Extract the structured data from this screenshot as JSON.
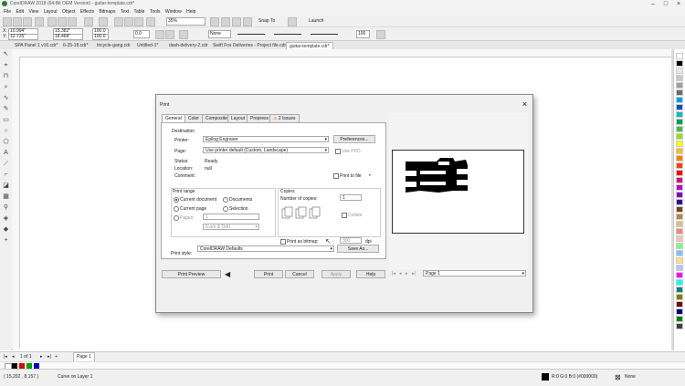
{
  "app": {
    "title": "CorelDRAW 2018 (64-Bit OEM Version) - guitar-template.cdr*"
  },
  "menu": [
    "File",
    "Edit",
    "View",
    "Layout",
    "Object",
    "Effects",
    "Bitmaps",
    "Text",
    "Table",
    "Tools",
    "Window",
    "Help"
  ],
  "toolbar": {
    "zoom": "35%",
    "snap_to": "Snap To",
    "launch": "Launch",
    "x": "10.994\"",
    "y": "12.725\"",
    "w": "15.382\"",
    "h": "18.468\"",
    "sx": "100.0",
    "sy": "100.0",
    "angle": "0.0",
    "outline": "None",
    "tab_value": "100"
  },
  "doc_tabs": [
    "SPA Panel 1 v16.cdr*",
    "6-25-18.cdr*",
    "tricycle-gang.cdr",
    "Untitled-1*",
    "dash-delivery-2.cdr",
    "Swift Fox Deliveries - Project file.cdr*",
    "guitar-template.cdr*"
  ],
  "dialog": {
    "title": "Print",
    "tabs": [
      "General",
      "Color",
      "Composite",
      "Layout",
      "Prepress",
      "2 Issues"
    ],
    "destination": {
      "heading": "Destination",
      "printer_label": "Printer:",
      "printer_value": "Epilog Engraver",
      "preferences": "Preferences...",
      "page_label": "Page:",
      "page_value": "Use printer default (Custom, Landscape)",
      "use_ppd": "Use PPD",
      "status_label": "Status:",
      "status_value": "Ready",
      "location_label": "Location:",
      "location_value": "null",
      "comment_label": "Comment:",
      "print_to_file": "Print to file"
    },
    "range": {
      "heading": "Print range",
      "current_document": "Current document",
      "documents": "Documents",
      "current_page": "Current page",
      "selection": "Selection",
      "pages": "Pages:",
      "pages_value": "1",
      "even_odd": "Even & Odd"
    },
    "copies": {
      "heading": "Copies",
      "number_label": "Number of copies:",
      "number_value": "1",
      "collate": "Collate"
    },
    "bitmap": {
      "label": "Print as bitmap:",
      "dpi_value": "300",
      "dpi_unit": "dpi"
    },
    "style": {
      "label": "Print style:",
      "value": "CorelDRAW Defaults",
      "save_as": "Save As..."
    },
    "buttons": {
      "preview": "Print Preview",
      "print": "Print",
      "cancel": "Cancel",
      "apply": "Apply",
      "help": "Help"
    },
    "page_nav": "Page 1"
  },
  "page_tab": "Page 1",
  "page_counter": "1 of 1",
  "status": {
    "coords": "( 15.202 , 8.157 )",
    "object": "Curve on Layer 1",
    "fill": "R:0 G:0 B:0 (#000000)",
    "outline": "None"
  },
  "colors": {
    "accent": "#f0a030",
    "palette": [
      "#ffffff",
      "#000000",
      "#e8e8e8",
      "#c8c8c8",
      "#a0a0a0",
      "#6e6e6e",
      "#00a0e0",
      "#0050c0",
      "#00c0c0",
      "#00a050",
      "#40c040",
      "#a0e000",
      "#ffff00",
      "#ffc000",
      "#ff8000",
      "#ff4000",
      "#ff0000",
      "#e0007a",
      "#c000c0",
      "#8000c0",
      "#4000a0",
      "#804020",
      "#c08040",
      "#e0c080",
      "#ff8080",
      "#ffc0c0",
      "#80ff80",
      "#80c0ff",
      "#ffe080",
      "#c0c0ff",
      "#ff00ff",
      "#00ffff",
      "#008080",
      "#808000",
      "#800000",
      "#000080",
      "#008000",
      "#404040"
    ]
  }
}
